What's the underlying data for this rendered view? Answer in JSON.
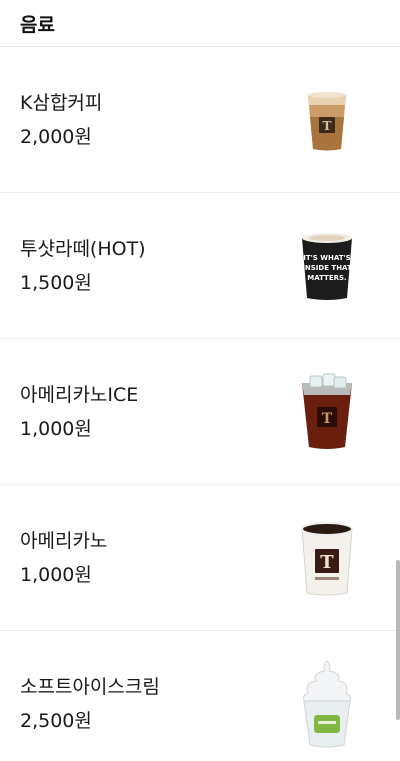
{
  "header": {
    "title": "음료"
  },
  "menu": {
    "items": [
      {
        "name": "K삼합커피",
        "price": "2,000원",
        "icon": "iced-latte-cup-icon"
      },
      {
        "name": "투샷라떼(HOT)",
        "price": "1,500원",
        "icon": "hot-latte-cup-icon"
      },
      {
        "name": "아메리카노ICE",
        "price": "1,000원",
        "icon": "iced-americano-cup-icon"
      },
      {
        "name": "아메리카노",
        "price": "1,000원",
        "icon": "hot-americano-cup-icon"
      },
      {
        "name": "소프트아이스크림",
        "price": "2,500원",
        "icon": "soft-ice-cream-cup-icon"
      }
    ]
  },
  "hot_cup_slogan": [
    "IT'S WHAT'S",
    "INSIDE THAT",
    "MATTERS."
  ],
  "colors": {
    "divider": "#ededed",
    "text": "#1a1a1a",
    "scrollbar": "#b9b9b9"
  }
}
